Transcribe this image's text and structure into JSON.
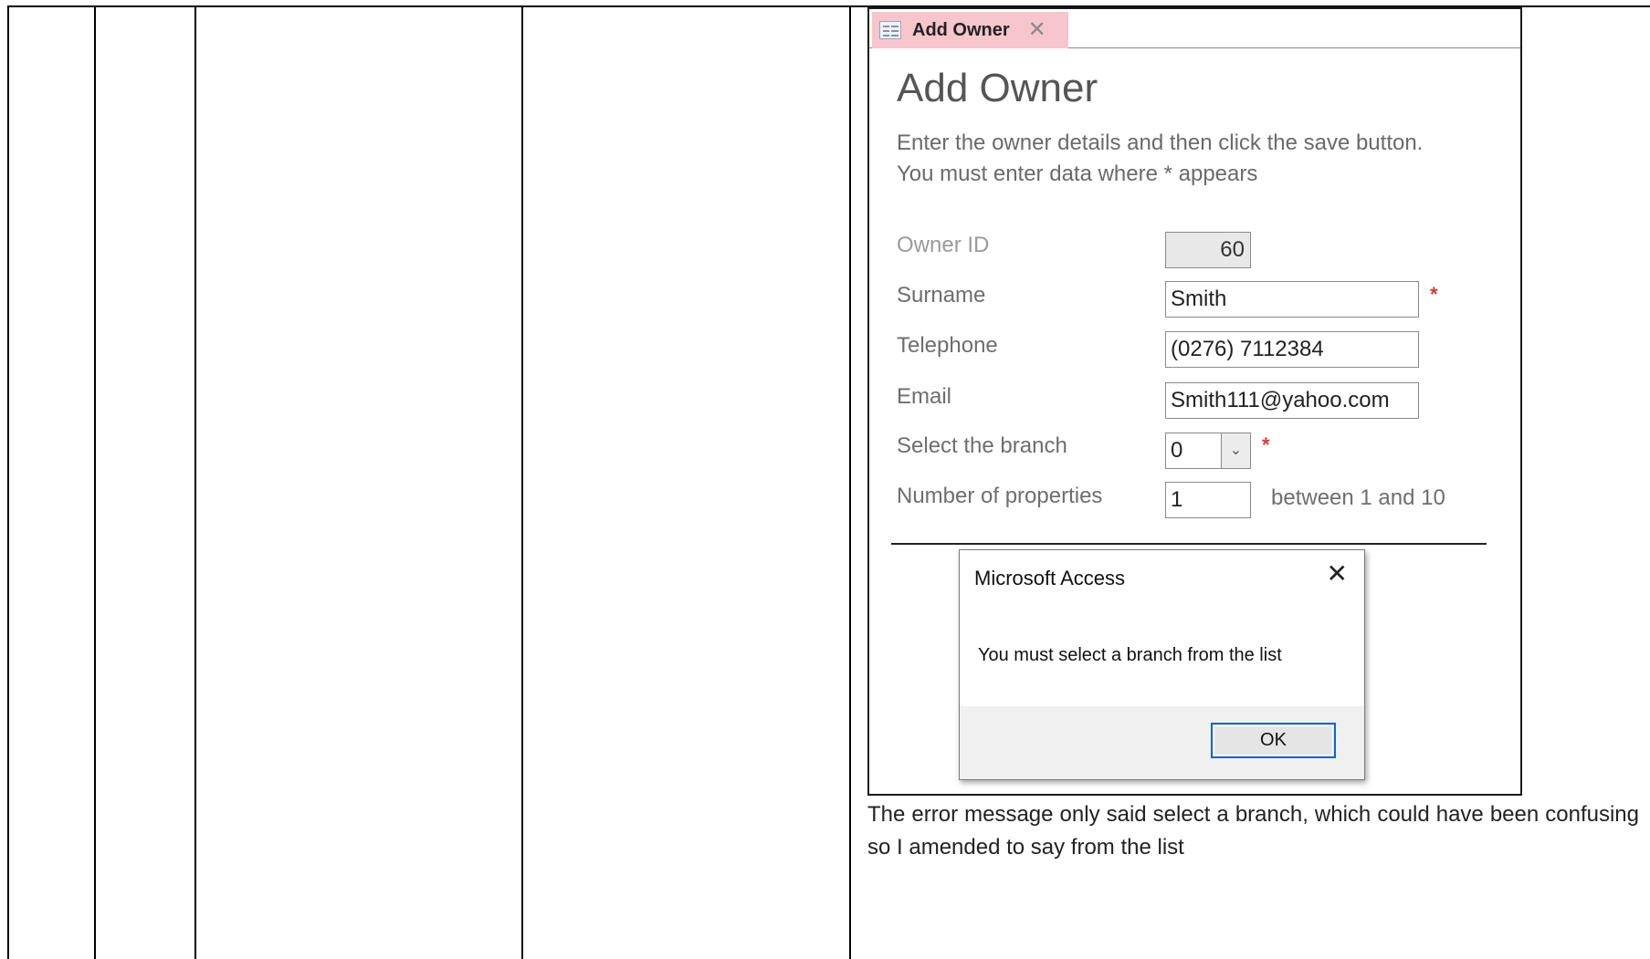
{
  "form_tab": {
    "label": "Add Owner",
    "icon": "form-icon",
    "close_icon": "close-icon"
  },
  "form": {
    "title": "Add Owner",
    "instructions": [
      "Enter the owner details and then click the save button.",
      "You must enter data where * appears"
    ],
    "fields": {
      "owner_id": {
        "label": "Owner ID",
        "value": "60"
      },
      "surname": {
        "label": "Surname",
        "value": "Smith",
        "required_mark": "*"
      },
      "telephone": {
        "label": "Telephone",
        "value": "(0276) 7112384"
      },
      "email": {
        "label": "Email",
        "value": "Smith111@yahoo.com"
      },
      "branch": {
        "label": "Select the branch",
        "value": "0",
        "required_mark": "*"
      },
      "properties": {
        "label": "Number of properties",
        "value": "1",
        "hint": "between 1 and 10"
      }
    }
  },
  "message_box": {
    "title": "Microsoft Access",
    "message": "You must select a branch from the list",
    "ok_label": "OK"
  },
  "caption": "The error message only said select a branch, which could have been confusing so I amended to say from the list",
  "colors": {
    "tab_active": "#f7c6cc",
    "required": "#d83a3a",
    "button_focus": "#0a64d8"
  }
}
